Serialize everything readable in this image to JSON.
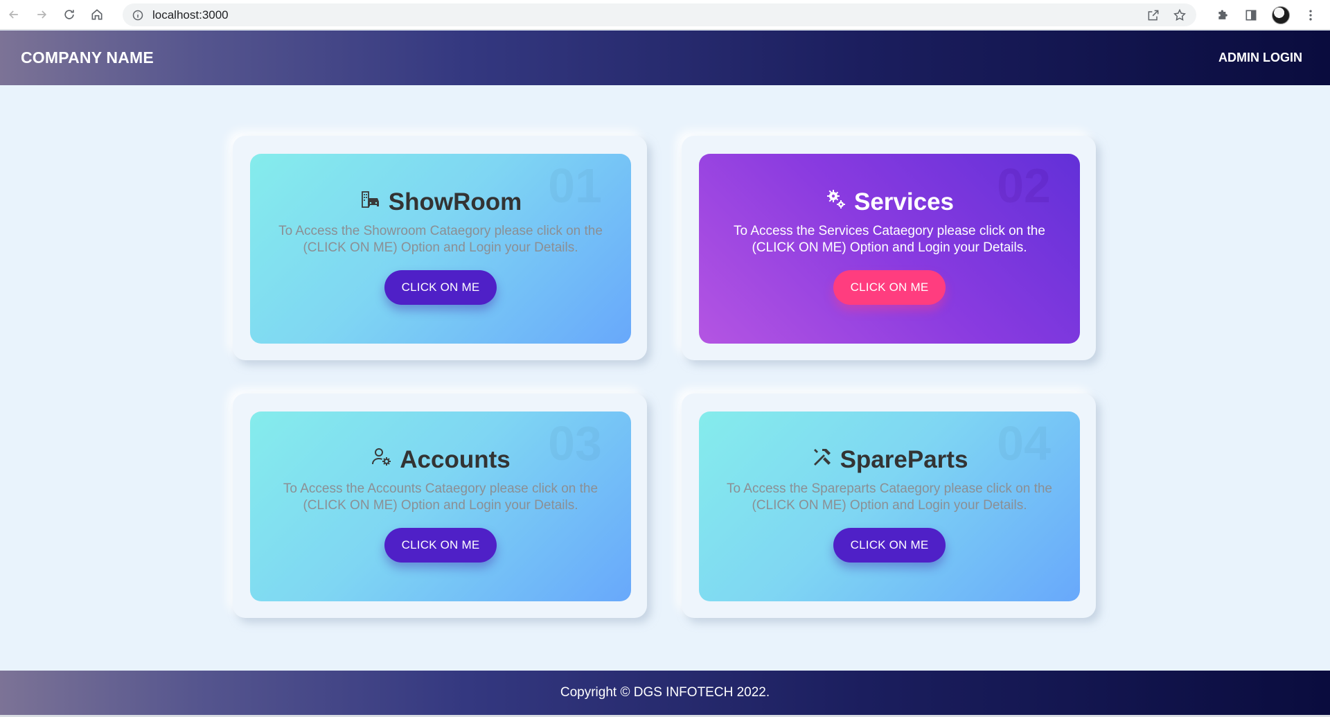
{
  "browser": {
    "url": "localhost:3000"
  },
  "header": {
    "brand": "COMPANY NAME",
    "admin_login": "ADMIN LOGIN"
  },
  "cards": [
    {
      "number": "01",
      "title": "ShowRoom",
      "icon": "showroom-car-icon",
      "description": "To Access the Showroom Cataegory please click on the (CLICK ON ME) Option and Login your Details.",
      "button": "CLICK ON ME"
    },
    {
      "number": "02",
      "title": "Services",
      "icon": "gears-icon",
      "description": "To Access the Services Cataegory please click on the (CLICK ON ME) Option and Login your Details.",
      "button": "CLICK ON ME"
    },
    {
      "number": "03",
      "title": "Accounts",
      "icon": "user-settings-icon",
      "description": "To Access the Accounts Cataegory please click on the (CLICK ON ME) Option and Login your Details.",
      "button": "CLICK ON ME"
    },
    {
      "number": "04",
      "title": "SpareParts",
      "icon": "tools-icon",
      "description": "To Access the Spareparts Cataegory please click on the (CLICK ON ME) Option and Login your Details.",
      "button": "CLICK ON ME"
    }
  ],
  "footer": {
    "copyright": "Copyright © DGS INFOTECH 2022."
  },
  "colors": {
    "header_dark": "#0a0c3e",
    "card_cyan": "#85ecec",
    "card_blue": "#68a8fb",
    "card_purple": "#8a3be0",
    "button_purple": "#4f20c7",
    "button_pink": "#ff3d7f",
    "page_background": "#e9f3fc"
  }
}
